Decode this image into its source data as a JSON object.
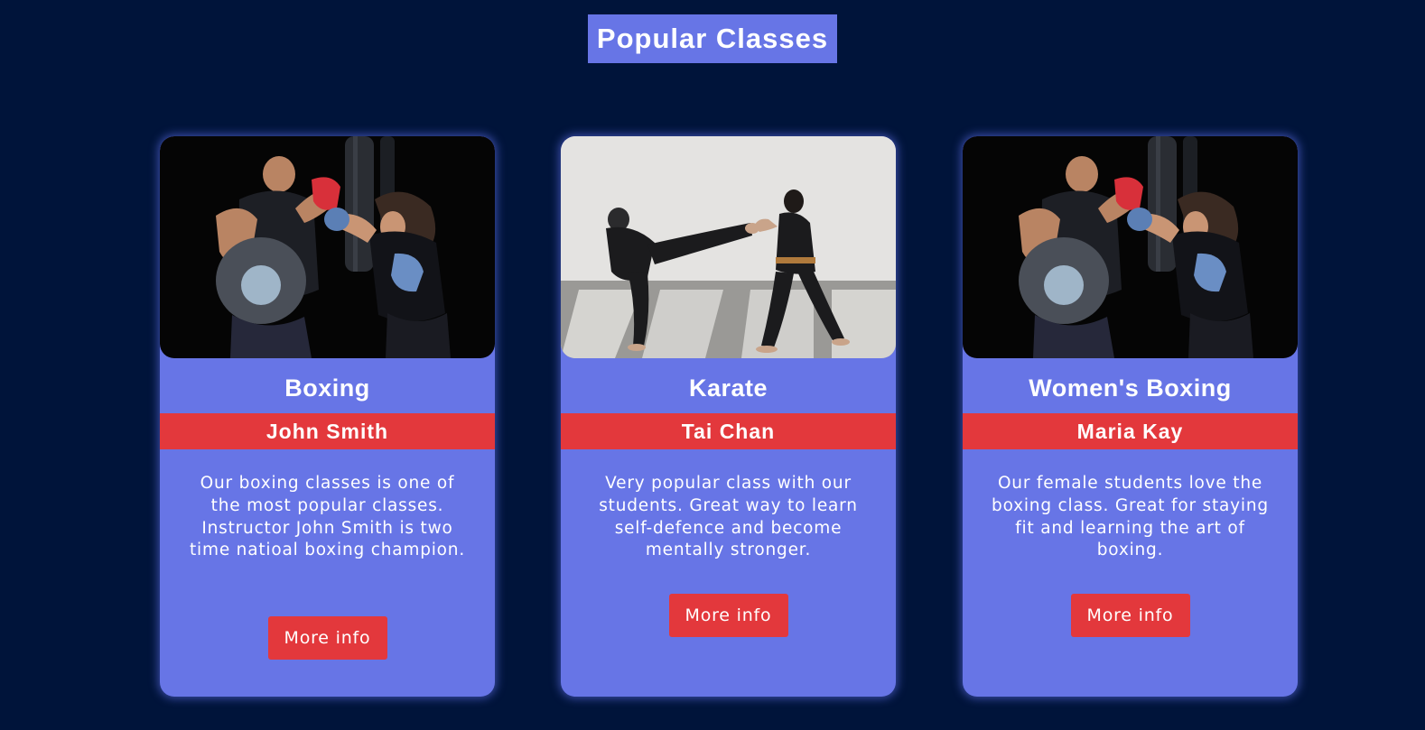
{
  "page": {
    "title": "Popular Classes"
  },
  "colors": {
    "background": "#00143a",
    "card": "#6775e6",
    "accent_red": "#e3383c",
    "text": "#ffffff"
  },
  "cards": [
    {
      "class_name": "Boxing",
      "instructor": "John Smith",
      "description": "Our boxing classes is one of the most popular classes. Instructor John Smith is two time natioal boxing champion.",
      "button_label": "More info",
      "photo": "boxing-training-photo"
    },
    {
      "class_name": "Karate",
      "instructor": "Tai Chan",
      "description": "Very popular class with our students. Great way to learn self-defence and become mentally stronger.",
      "button_label": "More info",
      "photo": "karate-kick-photo"
    },
    {
      "class_name": "Women's Boxing",
      "instructor": "Maria Kay",
      "description": "Our female students love the boxing class. Great for staying fit and learning the art of boxing.",
      "button_label": "More info",
      "photo": "boxing-training-photo"
    }
  ]
}
